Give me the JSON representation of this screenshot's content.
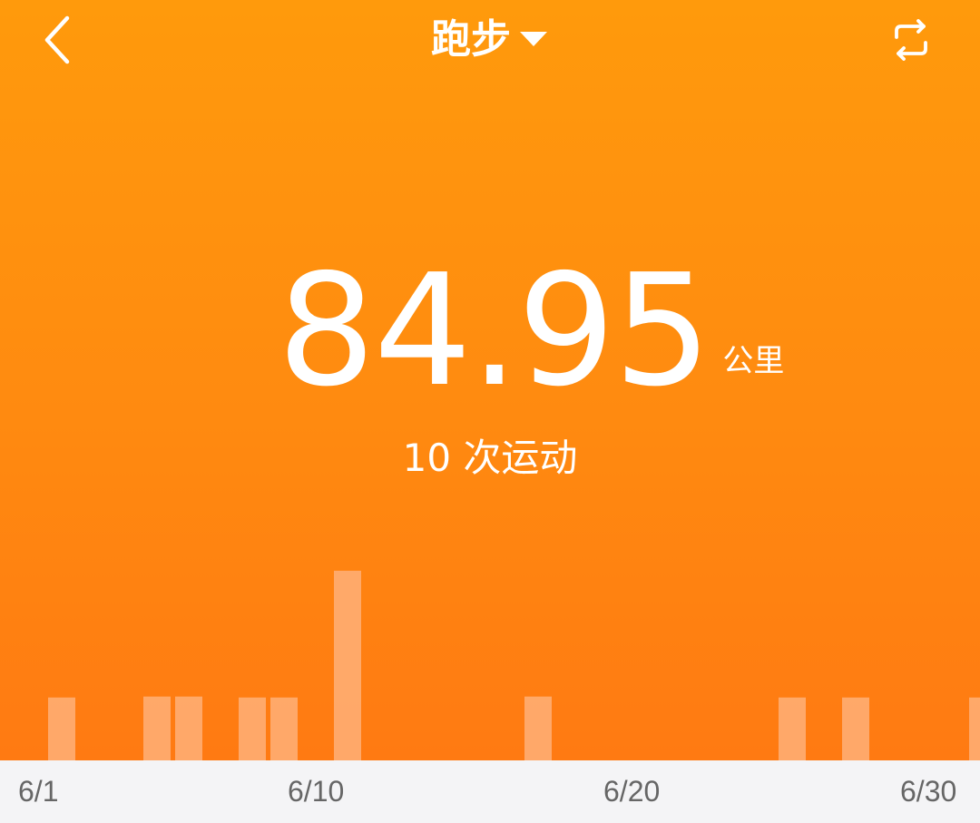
{
  "header": {
    "title": "跑步",
    "back_icon": "chevron-left-icon",
    "dropdown_icon": "caret-down-icon",
    "switch_icon": "repeat-icon"
  },
  "summary": {
    "distance": "84.95",
    "unit": "公里",
    "sessions_label": "10 次运动"
  },
  "colors": {
    "background_top": "#FF9A0C",
    "background_bottom": "#FF7A12",
    "bar": "#FFB079",
    "axis_background": "#F4F4F6"
  },
  "chart_data": {
    "type": "bar",
    "x_ticks": [
      "6/1",
      "6/10",
      "6/20",
      "6/30"
    ],
    "days": [
      1,
      2,
      3,
      4,
      5,
      6,
      7,
      8,
      9,
      10,
      11,
      12,
      13,
      14,
      15,
      16,
      17,
      18,
      19,
      20,
      21,
      22,
      23,
      24,
      25,
      26,
      27,
      28,
      29,
      30
    ],
    "values": [
      6.7,
      0,
      0,
      6.8,
      6.8,
      0,
      6.7,
      6.7,
      0,
      20.2,
      0,
      0,
      0,
      0,
      0,
      6.8,
      0,
      0,
      0,
      0,
      0,
      0,
      0,
      6.7,
      0,
      6.7,
      0,
      0,
      0,
      6.7
    ],
    "ylim": [
      0,
      23
    ],
    "grid": false
  }
}
